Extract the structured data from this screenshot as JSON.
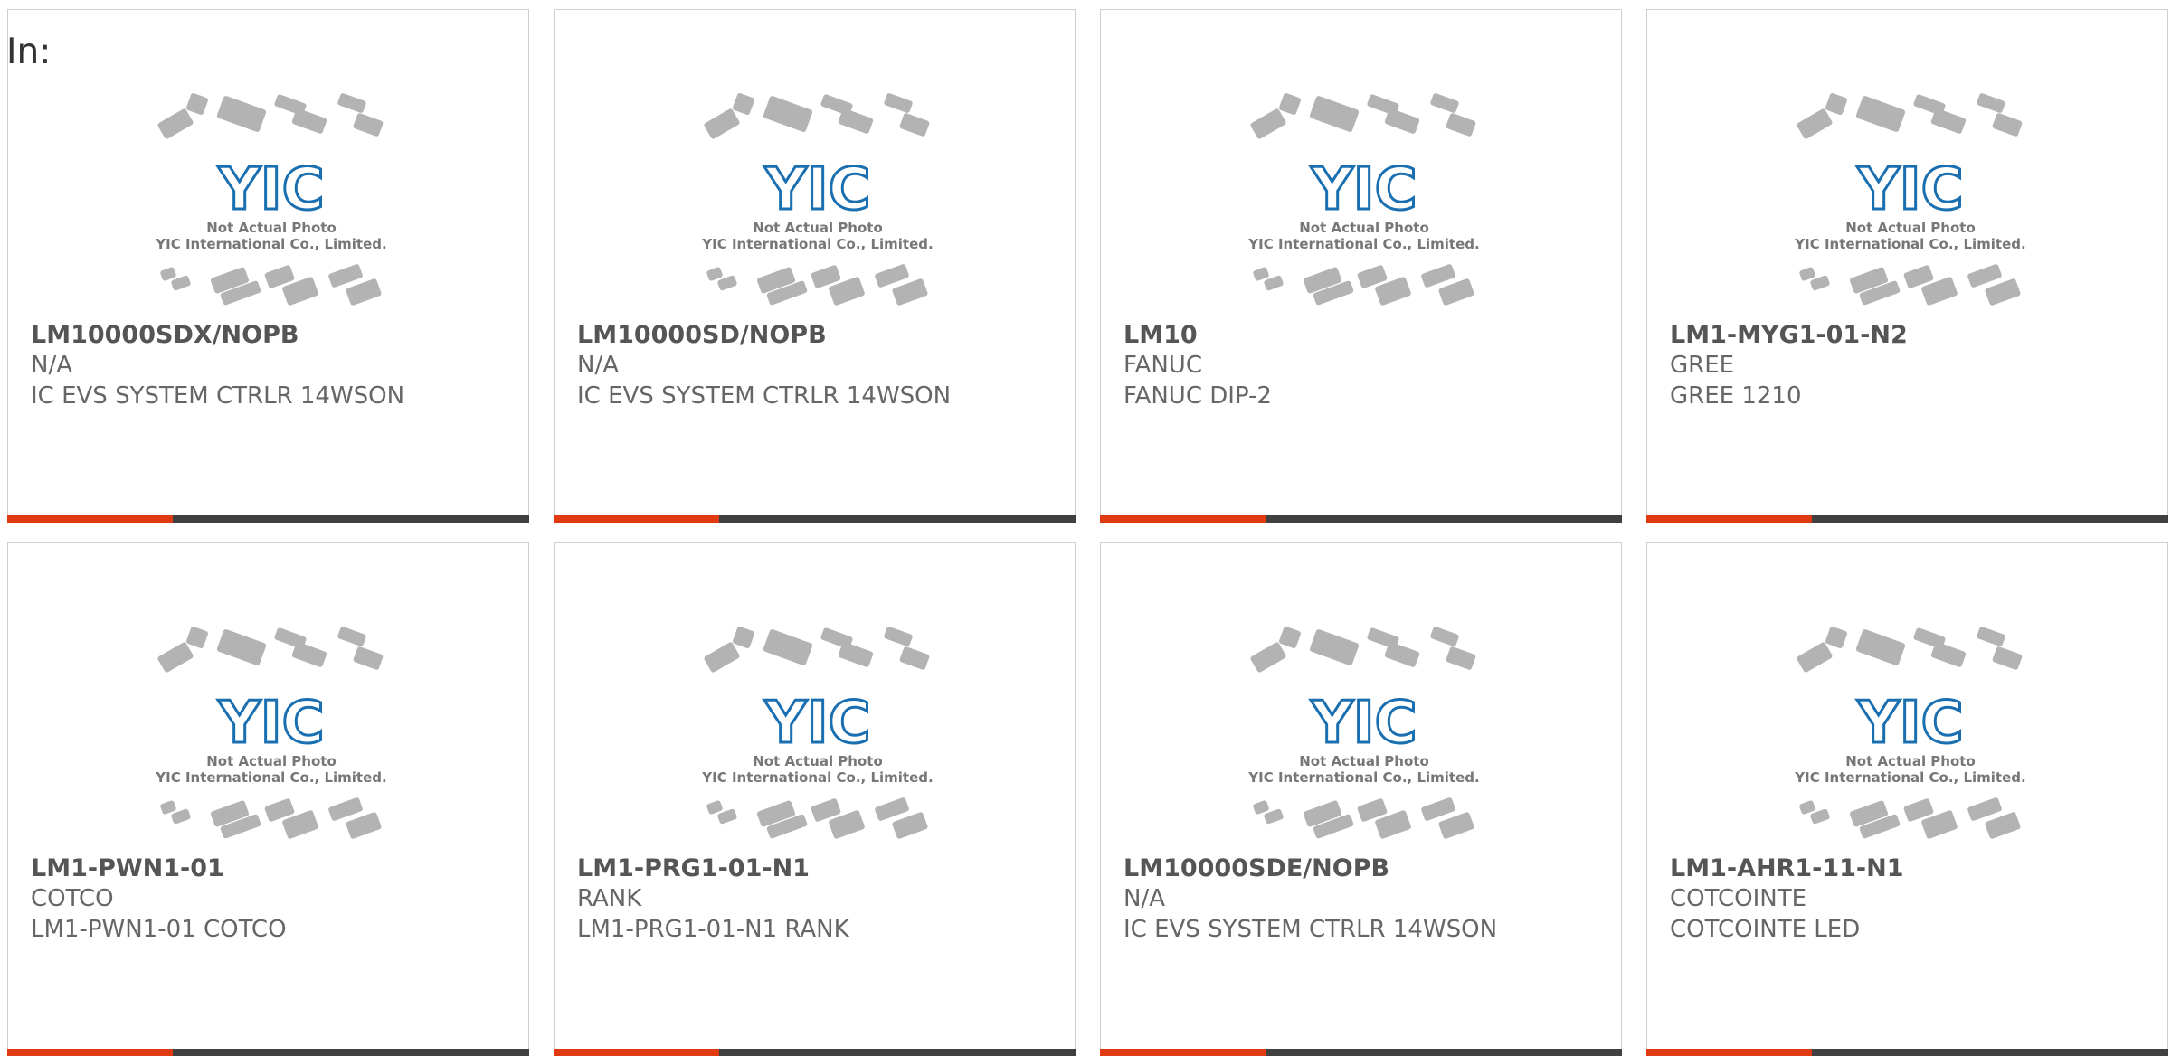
{
  "header": {
    "label": "In:"
  },
  "colors": {
    "accent": "#e03a12",
    "bar": "#404040",
    "logo_blue": "#1a6fb0",
    "chip_gray": "#b3b3b3"
  },
  "thumbnail": {
    "caption_line1": "Not Actual Photo",
    "caption_line2": "YIC International Co., Limited.",
    "logo_text": "YIC"
  },
  "products": [
    {
      "part": "LM10000SDX/NOPB",
      "manufacturer": "N/A",
      "description": "IC EVS SYSTEM CTRLR 14WSON"
    },
    {
      "part": "LM10000SD/NOPB",
      "manufacturer": "N/A",
      "description": "IC EVS SYSTEM CTRLR 14WSON"
    },
    {
      "part": "LM10",
      "manufacturer": "FANUC",
      "description": "FANUC DIP-2"
    },
    {
      "part": "LM1-MYG1-01-N2",
      "manufacturer": "GREE",
      "description": "GREE 1210"
    },
    {
      "part": "LM1-PWN1-01",
      "manufacturer": "COTCO",
      "description": "LM1-PWN1-01 COTCO"
    },
    {
      "part": "LM1-PRG1-01-N1",
      "manufacturer": "RANK",
      "description": "LM1-PRG1-01-N1 RANK"
    },
    {
      "part": "LM10000SDE/NOPB",
      "manufacturer": "N/A",
      "description": "IC EVS SYSTEM CTRLR 14WSON"
    },
    {
      "part": "LM1-AHR1-11-N1",
      "manufacturer": "COTCOINTE",
      "description": "COTCOINTE LED"
    }
  ]
}
